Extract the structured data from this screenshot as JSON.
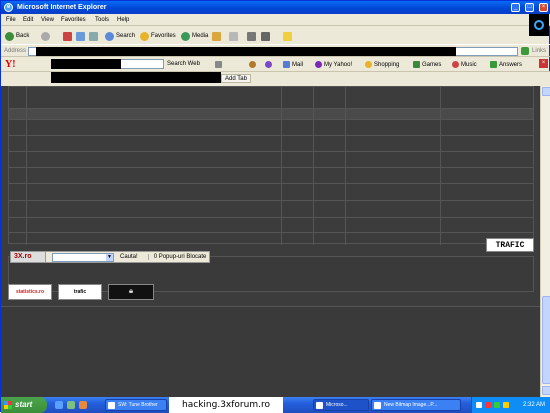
{
  "window": {
    "title": "Microsoft Internet Explorer"
  },
  "menu": [
    "File",
    "Edit",
    "View",
    "Favorites",
    "Tools",
    "Help"
  ],
  "toolbar": {
    "back": "Back",
    "search": "Search",
    "favorites": "Favorites",
    "media": "Media"
  },
  "address": {
    "label": "Address",
    "links": "Links"
  },
  "yahoo": {
    "search_web": "Search Web",
    "mail": "Mail",
    "my_yahoo": "My Yahoo!",
    "shopping": "Shopping",
    "games": "Games",
    "music": "Music",
    "answers": "Answers"
  },
  "tabs": {
    "add_tab": "Add Tab"
  },
  "footer": {
    "logo_3x": "3X.ro",
    "search_button": "Cauta!",
    "popups": "0 Popup-uri Blocate",
    "trafic_logo": "TRAFIC",
    "badge_statistics": "statistics.ro",
    "badge_trafic": "trafic"
  },
  "taskbar": {
    "start": "start",
    "tasks": [
      "SW: Tune Brother",
      "Microso...",
      "New Bitmap Image...P..."
    ],
    "clock": "2:32 AM"
  },
  "watermark": "hacking.3xforum.ro",
  "colors": {
    "title_blue": "#0046d5",
    "taskbar_blue": "#245edb",
    "start_green": "#3a8f3a",
    "content_bg": "#3c3c3c"
  }
}
